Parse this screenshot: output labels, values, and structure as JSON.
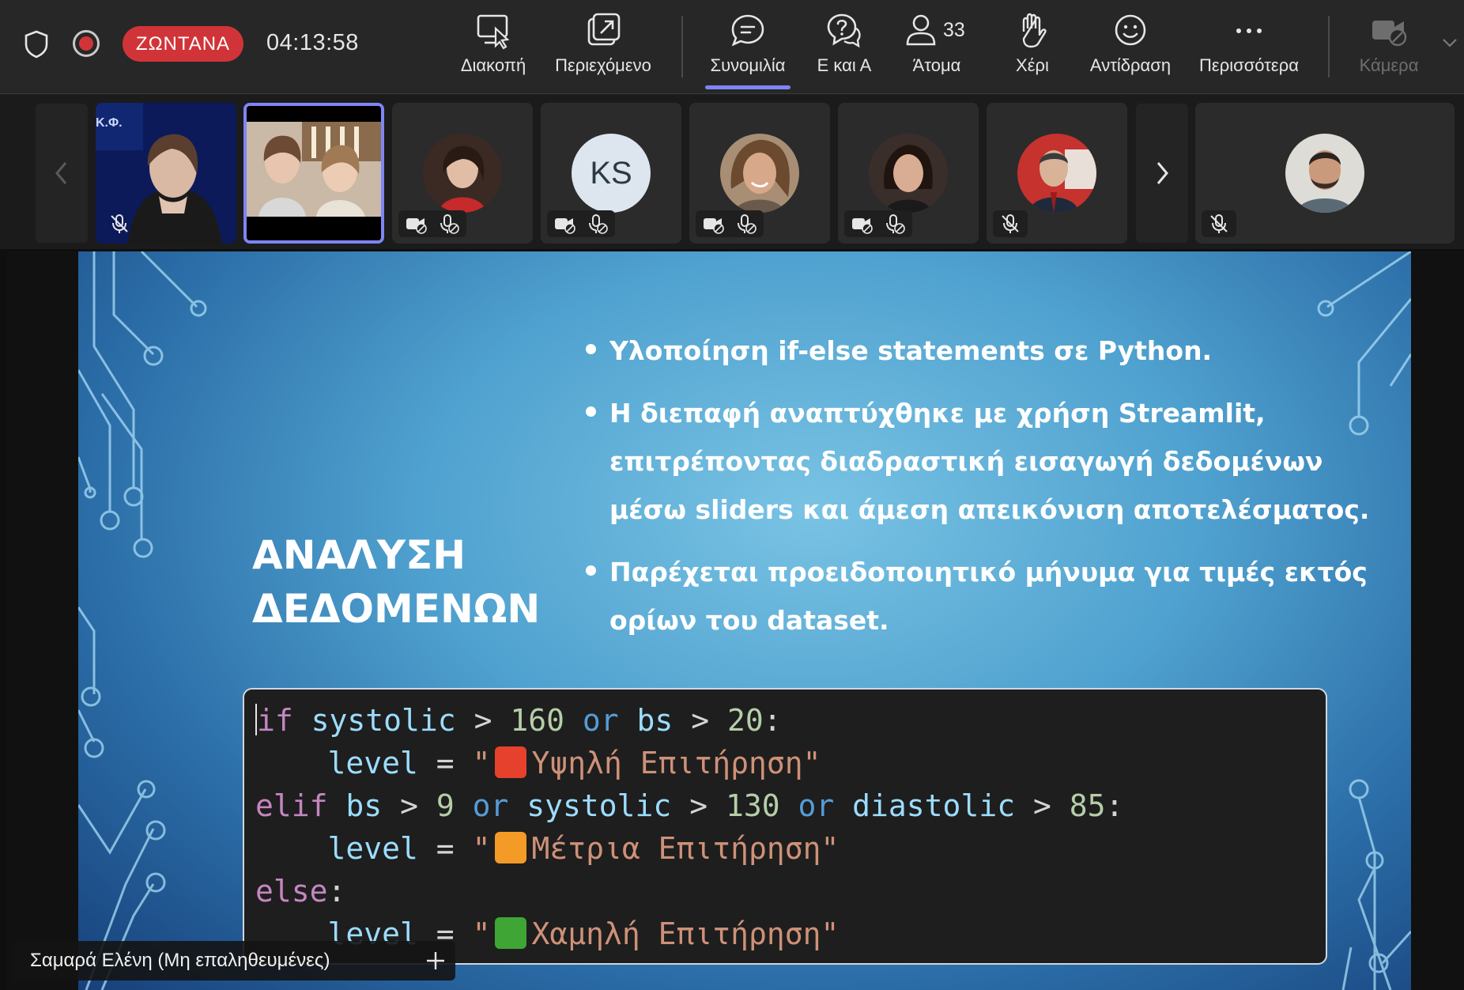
{
  "topbar": {
    "live_label": "ΖΩΝΤΑΝΑ",
    "timer": "04:13:58",
    "buttons": {
      "stop_label": "Διακοπή",
      "content_label": "Περιεχόμενο",
      "chat_label": "Συνομιλία",
      "qa_label": "Ε και Α",
      "people_label": "Άτομα",
      "people_count": "33",
      "hand_label": "Χέρι",
      "reaction_label": "Αντίδραση",
      "more_label": "Περισσότερα",
      "camera_label": "Κάμερα"
    },
    "accent_color": "#7f85f5",
    "live_color": "#d13438"
  },
  "participants": {
    "tiles": [
      {
        "kind": "video",
        "state": "muted"
      },
      {
        "kind": "video",
        "state": "active-speaker"
      },
      {
        "kind": "avatar",
        "state": "camera-off-mic-off"
      },
      {
        "kind": "initials",
        "initials": "KS",
        "state": "camera-off-mic-off"
      },
      {
        "kind": "avatar",
        "state": "camera-off-mic-off"
      },
      {
        "kind": "avatar",
        "state": "camera-off-mic-off"
      },
      {
        "kind": "avatar",
        "state": "muted"
      },
      {
        "kind": "avatar",
        "state": "muted"
      }
    ]
  },
  "slide": {
    "title_line1": "ΑΝΑΛΥΣΗ",
    "title_line2": "ΔΕΔΟΜΕΝΩΝ",
    "bullets": [
      "Υλοποίηση if-else statements σε Python.",
      "Η διεπαφή αναπτύχθηκε με χρήση Streamlit, επιτρέποντας διαδραστική εισαγωγή δεδομένων μέσω sliders και άμεση απεικόνιση αποτελέσματος.",
      "Παρέχεται προειδοποιητικό μήνυμα για τιμές εκτός ορίων του dataset."
    ],
    "code": {
      "l1": {
        "kw": "if",
        "var1": "systolic",
        "op1": ">",
        "n1": "160",
        "or1": "or",
        "var2": "bs",
        "op2": ">",
        "n2": "20",
        "end": ":"
      },
      "l2": {
        "var": "level",
        "op": "=",
        "text": "Υψηλή Επιτήρηση",
        "square_color": "#e5412c"
      },
      "l3": {
        "kw": "elif",
        "var1": "bs",
        "op1": ">",
        "n1": "9",
        "or1": "or",
        "var2": "systolic",
        "op2": ">",
        "n2": "130",
        "or2": "or",
        "var3": "diastolic",
        "op3": ">",
        "n3": "85",
        "end": ":"
      },
      "l4": {
        "var": "level",
        "op": "=",
        "text": "Μέτρια Επιτήρηση",
        "square_color": "#f49a26"
      },
      "l5": {
        "kw": "else",
        "end": ":"
      },
      "l6": {
        "var": "level",
        "op": "=",
        "text": "Χαμηλή Επιτήρηση",
        "square_color": "#3fa535"
      }
    }
  },
  "speaker_tag": {
    "name": "Σαμαρά Ελένη (Μη επαληθευμένες)"
  }
}
